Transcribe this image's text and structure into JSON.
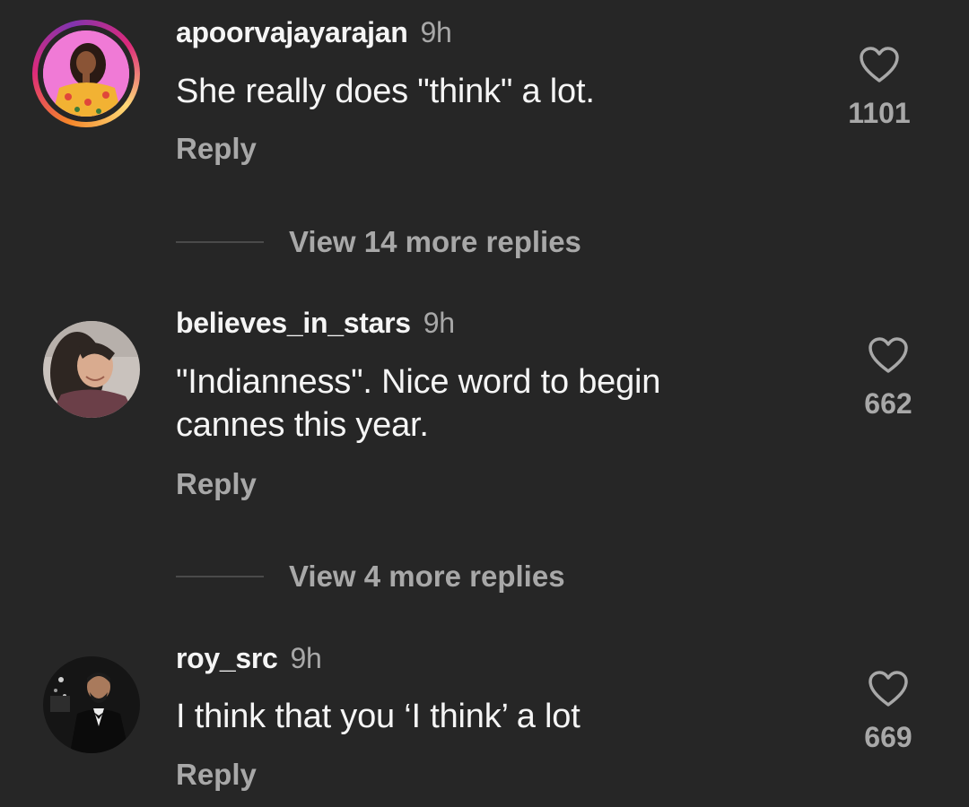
{
  "colors": {
    "background": "#262626",
    "primary_text": "#f5f5f5",
    "secondary_text": "#a8a8a8",
    "divider": "#4a4a4a"
  },
  "comments": [
    {
      "username": "apoorvajayarajan",
      "time": "9h",
      "text": "She really does \"think\" a lot.",
      "reply_label": "Reply",
      "like_icon": "heart-outline-icon",
      "likes": "1101",
      "has_story_ring": true
    },
    {
      "username": "believes_in_stars",
      "time": "9h",
      "text": "\"Indianness\". Nice word to begin cannes this year.",
      "reply_label": "Reply",
      "like_icon": "heart-outline-icon",
      "likes": "662",
      "has_story_ring": false
    },
    {
      "username": "roy_src",
      "time": "9h",
      "text": "I think that you ‘I think’ a lot",
      "reply_label": "Reply",
      "like_icon": "heart-outline-icon",
      "likes": "669",
      "has_story_ring": false
    }
  ],
  "view_more": [
    {
      "label": "View 14 more replies"
    },
    {
      "label": "View 4 more replies"
    }
  ]
}
